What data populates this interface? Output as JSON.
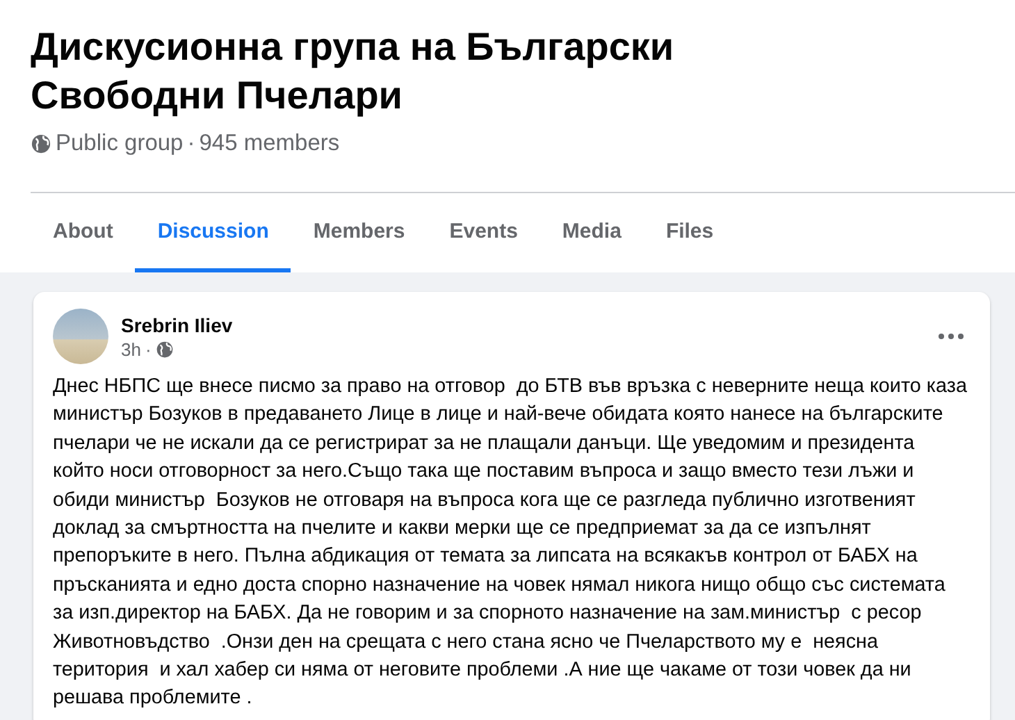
{
  "group": {
    "title": "Дискусионна група на Български Свободни Пчелари",
    "privacy": "Public group",
    "separator": "·",
    "members": "945 members"
  },
  "tabs": [
    {
      "label": "About",
      "selected": false
    },
    {
      "label": "Discussion",
      "selected": true
    },
    {
      "label": "Members",
      "selected": false
    },
    {
      "label": "Events",
      "selected": false
    },
    {
      "label": "Media",
      "selected": false
    },
    {
      "label": "Files",
      "selected": false
    }
  ],
  "post": {
    "author": "Srebrin Iliev",
    "time": "3h",
    "separator": "·",
    "text": "Днес НБПС ще внесе писмо за право на отговор  до БТВ във връзка с неверните неща които каза министър Бозуков в предаването Лице в лице и най-вече обидата която нанесе на българските пчелари че не искали да се регистрират за не плащали данъци. Ще уведомим и президента който носи отговорност за него.Също така ще поставим въпроса и защо вместо тези лъжи и обиди министър  Бозуков не отговаря на въпроса кога ще се разгледа публично изготвеният доклад за смъртността на пчелите и какви мерки ще се предприемат за да се изпълнят препоръките в него. Пълна абдикация от темата за липсата на всякакъв контрол от БАБХ на пръсканията и едно доста спорно назначение на човек нямал никога нищо общо със системата за изп.директор на БАБХ. Да не говорим и за спорното назначение на зам.министър  с ресор Животновъдство  .Онзи ден на срещата с него стана ясно че Пчеларството му е  неясна  територия  и хал хабер си няма от неговите проблеми .А ние ще чакаме от този човек да ни решава проблемите ."
  }
}
